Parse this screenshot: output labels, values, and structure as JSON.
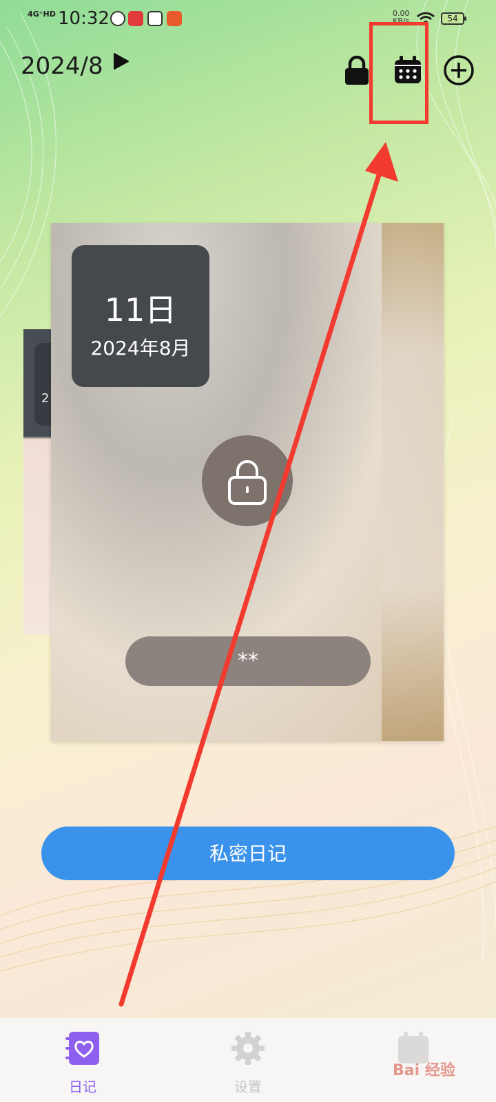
{
  "status_bar": {
    "network": "4G⁺HD",
    "time": "10:32",
    "speed_value": "0.00",
    "speed_unit": "KB/s",
    "battery": "54"
  },
  "header": {
    "month": "2024/8",
    "icons": [
      "play-icon",
      "lock-icon",
      "calendar-icon",
      "add-circle-icon"
    ]
  },
  "card": {
    "day": "11日",
    "year_month": "2024年8月",
    "masked_text": "**"
  },
  "back_card": {
    "fragment": "2"
  },
  "private_button": "私密日记",
  "bottom_nav": {
    "items": [
      {
        "label": "日记",
        "icon": "heart-diary-icon",
        "active": true
      },
      {
        "label": "设置",
        "icon": "gear-icon",
        "active": false
      },
      {
        "label": "",
        "icon": "calendar-tab-icon",
        "active": false
      }
    ]
  },
  "colors": {
    "accent_button": "#3a92ea",
    "nav_active": "#8e60ef",
    "annotation_red": "#f23a2f"
  },
  "watermark": "Bai 经验"
}
